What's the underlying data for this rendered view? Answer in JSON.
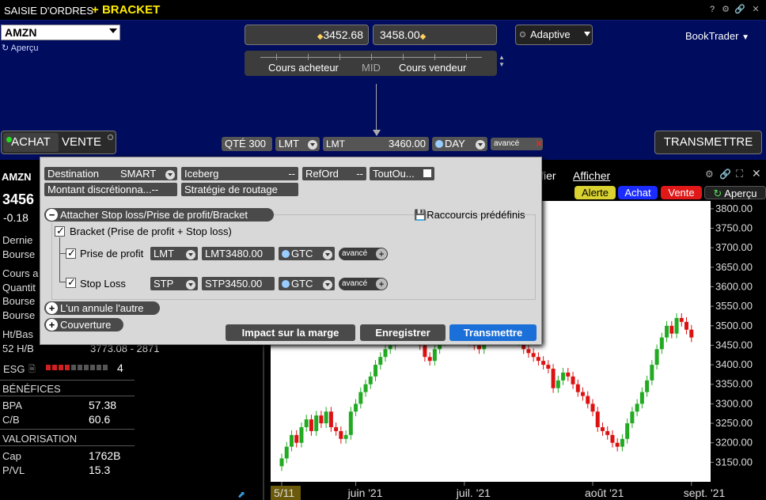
{
  "title": {
    "window": "SAISIE D'ORDRES",
    "plus": "+",
    "bracket": "BRACKET",
    "help": "?"
  },
  "order": {
    "symbol": "AMZN",
    "apercu": "Aperçu",
    "bid": "3452.68",
    "ask": "3458.00",
    "bid_label": "Cours acheteur",
    "mid_label": "MID",
    "ask_label": "Cours vendeur",
    "algo": "Adaptive",
    "booktrader": "BookTrader",
    "buy": "ACHAT",
    "sell": "VENTE",
    "qty": "QTÉ 300",
    "type": "LMT",
    "price_label": "LMT",
    "price": "3460.00",
    "tif": "DAY",
    "advanced": "avancé",
    "transmit": "TRANSMETTRE"
  },
  "quote": {
    "ticker": "AMZN",
    "price": "3456",
    "change": "-0.18",
    "lines": [
      "Dernie",
      "Bourse",
      "Cours a",
      "Quantit",
      "Bourse",
      "Bourse",
      "Ht/Bas",
      "52 H/B"
    ],
    "hb52": "3773.08 - 2871",
    "esg_label": "ESG",
    "esg_score": "4",
    "esg_rating": 4,
    "esg_max": 10
  },
  "fundamentals": {
    "benefices": "BÉNÉFICES",
    "bpa_label": "BPA",
    "bpa": "57.38",
    "cb_label": "C/B",
    "cb": "60.6",
    "valorisation": "VALORISATION",
    "cap_label": "Cap",
    "cap": "1762B",
    "pvl_label": "P/VL",
    "pvl": "15.3"
  },
  "chart_toolbar": {
    "ifier": "ifier",
    "afficher": "Afficher",
    "alerte": "Alerte",
    "achat": "Achat",
    "vente": "Vente",
    "apercu": "Aperçu"
  },
  "modal": {
    "destination": "Destination",
    "destination_val": "SMART",
    "iceberg": "Iceberg",
    "iceberg_val": "--",
    "reford": "RefOrd",
    "reford_val": "--",
    "toutou": "ToutOu...",
    "montant": "Montant discrétionna...--",
    "strategie": "Stratégie de routage",
    "attach": "Attacher Stop loss/Prise de profit/Bracket",
    "raccourcis": "Raccourcis prédéfinis",
    "bracket_label": "Bracket (Prise de profit + Stop loss)",
    "tp_label": "Prise de profit",
    "tp_type": "LMT",
    "tp_price": "LMT3480.00",
    "tp_tif": "GTC",
    "sl_label": "Stop Loss",
    "sl_type": "STP",
    "sl_price": "STP3450.00",
    "sl_tif": "GTC",
    "advanced": "avancé",
    "oca": "L'un annule l'autre",
    "couverture": "Couverture",
    "impact": "Impact sur la marge",
    "enregistrer": "Enregistrer",
    "transmettre": "Transmettre"
  },
  "colors": {
    "up": "#22aa22",
    "down": "#dd1111",
    "accent": "#1a6fd8",
    "panel": "#000c5e"
  },
  "chart_data": {
    "type": "candlestick",
    "ylim": [
      3100,
      3820
    ],
    "y_ticks": [
      "3800.00",
      "3750.00",
      "3700.00",
      "3650.00",
      "3600.00",
      "3550.00",
      "3500.00",
      "3450.00",
      "3400.00",
      "3350.00",
      "3300.00",
      "3250.00",
      "3200.00",
      "3150.00"
    ],
    "x_labels": [
      "5/11",
      "juin '21",
      "juil. '21",
      "août '21",
      "sept. '21"
    ],
    "x_label_idx": [
      0,
      15,
      37,
      57,
      77
    ],
    "gap": [
      42,
      48
    ],
    "close": [
      3160,
      3190,
      3220,
      3200,
      3240,
      3260,
      3230,
      3270,
      3250,
      3280,
      3240,
      3230,
      3210,
      3220,
      3280,
      3300,
      3330,
      3350,
      3370,
      3400,
      3420,
      3440,
      3450,
      3470,
      3480,
      3500,
      3490,
      3470,
      3450,
      3420,
      3410,
      3440,
      3460,
      3470,
      3480,
      3490,
      3500,
      3470,
      3460,
      3450,
      3440,
      3460,
      3460,
      3440,
      3430,
      3420,
      3410,
      3400,
      3390,
      3340,
      3360,
      3380,
      3370,
      3350,
      3330,
      3320,
      3300,
      3280,
      3240,
      3230,
      3220,
      3200,
      3190,
      3210,
      3250,
      3280,
      3300,
      3330,
      3360,
      3400,
      3440,
      3470,
      3500,
      3480,
      3520,
      3510,
      3490,
      3470
    ]
  }
}
